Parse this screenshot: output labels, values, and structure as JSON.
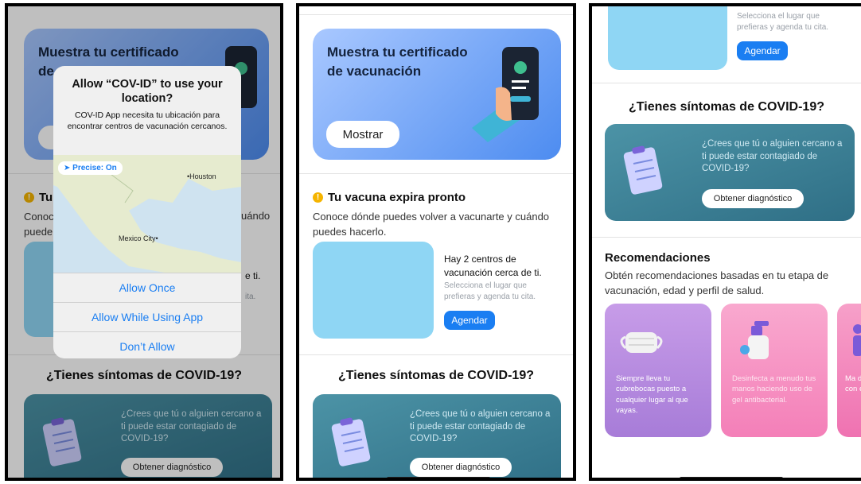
{
  "hero": {
    "title": "Muestra tu certificado de vacunación",
    "button": "Mostrar"
  },
  "alert": {
    "title": "Allow “COV-ID” to use your location?",
    "message": "COV-ID App necesita tu ubicación para encontrar centros de vacunación cercanos.",
    "precise": "Precise: On",
    "map_labels": {
      "houston": "Houston",
      "mexico": "Mexico City"
    },
    "buttons": [
      "Allow Once",
      "Allow While Using App",
      "Don’t Allow"
    ]
  },
  "panel1": {
    "hero_visible_1": "Muestra tu certificado",
    "hero_visible_2": "de",
    "warn_visible": "Tu",
    "desc_visible_left_1": "Conoc",
    "desc_visible_left_2": "puede",
    "desc_visible_right": "uándo",
    "center_visible": "e ti.",
    "center_sub_visible": "ita."
  },
  "vaccine": {
    "title": "Tu vacuna expira pronto",
    "desc": "Conoce dónde puedes volver a vacunarte y cuándo puedes hacerlo.",
    "centers": "Hay 2 centros de vacunación cerca de ti.",
    "centers_sub": "Selecciona el lugar que prefieras y agenda tu cita.",
    "button": "Agendar"
  },
  "symptoms": {
    "title": "¿Tienes síntomas de COVID-19?",
    "question": "¿Crees que tú o alguien cercano a ti puede estar contagiado de COVID-19?",
    "button": "Obtener diagnóstico"
  },
  "recs": {
    "title": "Recomendaciones",
    "desc": "Obtén recomendaciones basadas en tu etapa de vacunación, edad y perfil de salud.",
    "cards": [
      {
        "text": "Siempre lleva tu cubrebocas puesto a cualquier lugar al que vayas.",
        "color": "#b58be0"
      },
      {
        "text": "Desinfecta a menudo tus manos haciendo uso de gel antibacterial.",
        "color": "#f58fbf"
      },
      {
        "text": "Ma dis con en",
        "color": "#f07ab5"
      }
    ]
  },
  "colors": {
    "accent": "#1a7ef2",
    "hero": "#4d8cf0",
    "symptoms": "#2f6f86",
    "centers": "#8fd6f4"
  }
}
